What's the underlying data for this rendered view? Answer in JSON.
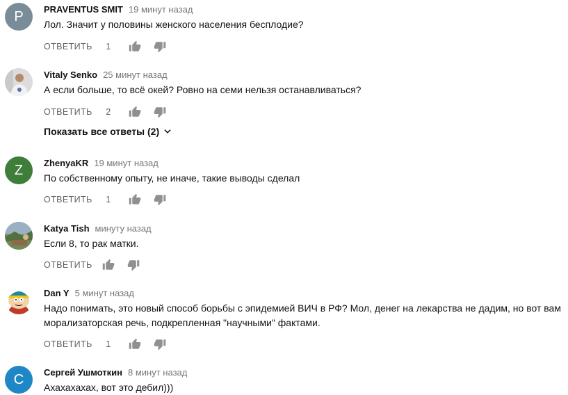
{
  "colors": {
    "avatar_p": "#7b8c99",
    "avatar_z": "#3f7d3a",
    "avatar_c": "#1e88c7",
    "meta_gray": "#767676",
    "action_gray": "#606060"
  },
  "comments": [
    {
      "avatar_letter": "P",
      "author": "PRAVENTUS SMIT",
      "time": "19 минут назад",
      "text": "Лол.  Значит  у половины женского населения  бесплодие?",
      "reply": "ОТВЕТИТЬ",
      "likes": "1"
    },
    {
      "avatar_icon": "user-photo",
      "author": "Vitaly Senko",
      "time": "25 минут назад",
      "text": "А если больше, то всё окей? Ровно на семи нельзя останавливаться?",
      "reply": "ОТВЕТИТЬ",
      "likes": "2",
      "show_replies": "Показать все ответы (2)"
    },
    {
      "avatar_letter": "Z",
      "author": "ZhenyaKR",
      "time": "19 минут назад",
      "text": "По собственному опыту, не иначе, такие выводы сделал",
      "reply": "ОТВЕТИТЬ",
      "likes": "1"
    },
    {
      "avatar_icon": "landscape-photo",
      "author": "Katya Tish",
      "time": "минуту назад",
      "text": "Если 8, то рак матки.",
      "reply": "ОТВЕТИТЬ",
      "likes": ""
    },
    {
      "avatar_icon": "cartoon-character",
      "author": "Dan Y",
      "time": "5 минут назад",
      "text": "Надо понимать, это новый способ борьбы с эпидемией ВИЧ в РФ? Мол, денег на лекарства не дадим, но вот вам морализаторская речь, подкрепленная \"научными\" фактами.",
      "reply": "ОТВЕТИТЬ",
      "likes": "1"
    },
    {
      "avatar_letter": "С",
      "author": "Сергей Ушмоткин",
      "time": "8 минут назад",
      "text": "Ахахахахах, вот это дебил)))"
    }
  ]
}
